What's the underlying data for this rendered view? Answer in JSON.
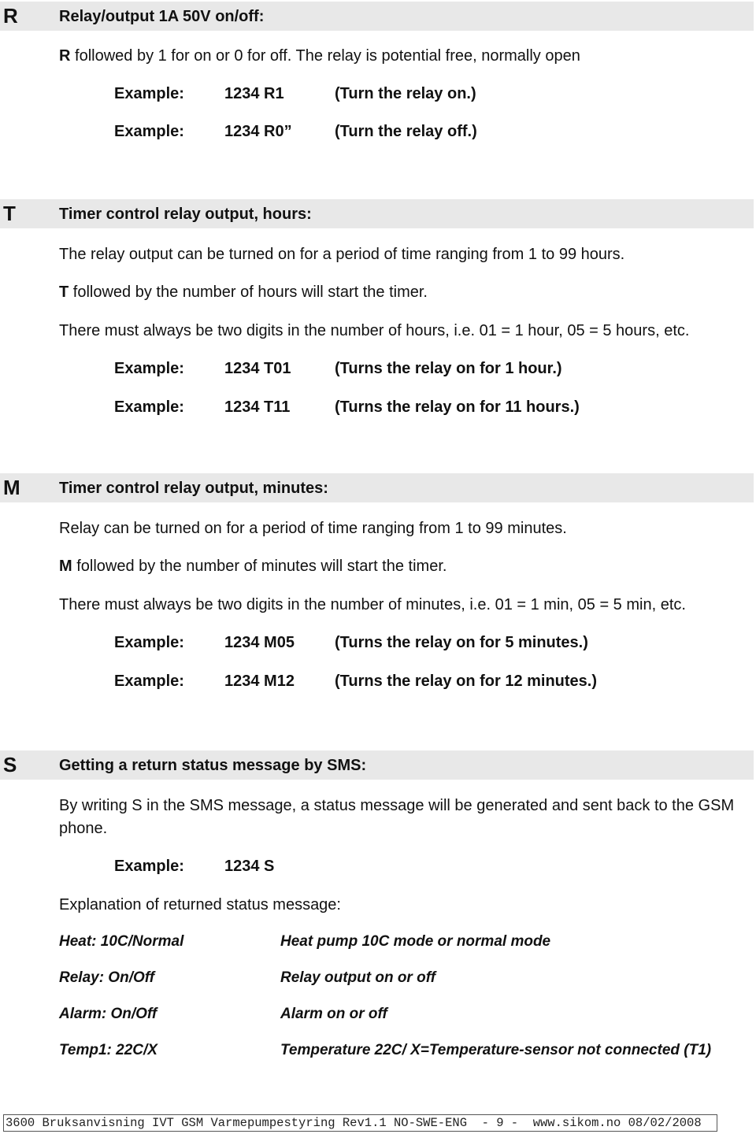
{
  "sections": {
    "r": {
      "letter": "R",
      "title": "Relay/output 1A 50V on/off:",
      "desc_bold": "R",
      "desc_rest": " followed by 1 for on or 0 for off.   The relay is potential free, normally open",
      "examples": [
        {
          "label": "Example:",
          "code": "1234 R1",
          "note": "(Turn the relay on.)"
        },
        {
          "label": "Example:",
          "code": "1234 R0”",
          "note": "(Turn the relay off.)"
        }
      ]
    },
    "t": {
      "letter": "T",
      "title": "Timer control relay output, hours:",
      "line1": "The relay output can be turned on for a period of time ranging from 1 to 99 hours.",
      "line2_bold": "T",
      "line2_rest": " followed by the number of hours will start the timer.",
      "line3": "There must always be two digits in the number of hours, i.e.  01 = 1 hour, 05 = 5 hours, etc.",
      "examples": [
        {
          "label": "Example:",
          "code": "1234 T01",
          "note": "(Turns the relay on for 1 hour.)"
        },
        {
          "label": "Example:",
          "code": "1234 T11",
          "note": "(Turns the relay on for 11 hours.)"
        }
      ]
    },
    "m": {
      "letter": "M",
      "title": "Timer control relay output, minutes:",
      "line1": "Relay can be turned on for a period of time ranging from 1 to 99 minutes.",
      "line2_bold": "M",
      "line2_rest": "  followed by the number of minutes will start the timer.",
      "line3": "There must always be two digits in the number of minutes, i.e.  01 = 1 min, 05 = 5 min, etc.",
      "examples": [
        {
          "label": "Example:",
          "code": "1234 M05",
          "note": "(Turns the relay on for 5 minutes.)"
        },
        {
          "label": "Example:",
          "code": "1234 M12",
          "note": "(Turns the relay on for 12 minutes.)"
        }
      ]
    },
    "s": {
      "letter": "S",
      "title": "Getting a return status message by SMS:",
      "para": "By writing S in the SMS message, a status message will be generated and sent back to the GSM phone.",
      "example": {
        "label": "Example:",
        "code": "1234 S"
      },
      "explanation_heading": "Explanation of returned status message:",
      "status_items": [
        {
          "key": "Heat: 10C/Normal",
          "meaning": "Heat pump 10C mode or normal mode"
        },
        {
          "key": "Relay: On/Off",
          "meaning": "Relay output on or off"
        },
        {
          "key": "Alarm: On/Off",
          "meaning": "Alarm on or off"
        },
        {
          "key": "Temp1: 22C/X",
          "meaning": "Temperature 22C/ X=Temperature-sensor not connected (T1)"
        }
      ]
    }
  },
  "footer": {
    "text": "3600 Bruksanvisning IVT GSM Varmepumpestyring Rev1.1 NO-SWE-ENG  - 9 -  www.sikom.no 08/02/2008"
  }
}
